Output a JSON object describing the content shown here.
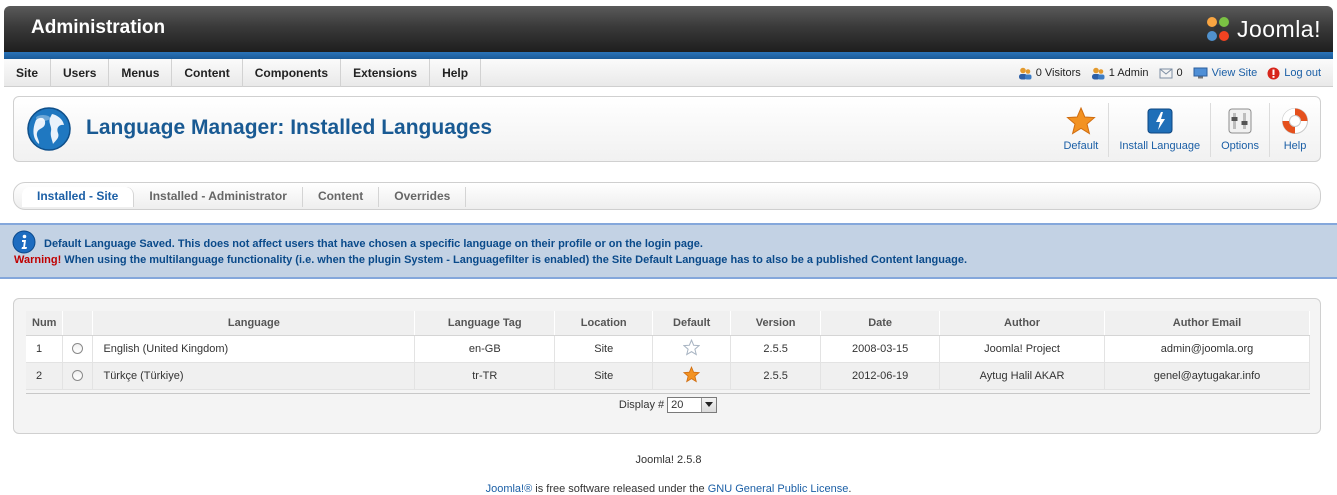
{
  "header": {
    "title": "Administration",
    "logo_text": "Joomla!"
  },
  "menu": {
    "items": [
      "Site",
      "Users",
      "Menus",
      "Content",
      "Components",
      "Extensions",
      "Help"
    ]
  },
  "status": {
    "visitors": "0 Visitors",
    "admins": "1 Admin",
    "messages": "0",
    "view_site": "View Site",
    "logout": "Log out"
  },
  "page": {
    "title": "Language Manager: Installed Languages"
  },
  "toolbar": {
    "default": "Default",
    "install": "Install Language",
    "options": "Options",
    "help": "Help"
  },
  "submenu": {
    "items": [
      "Installed - Site",
      "Installed - Administrator",
      "Content",
      "Overrides"
    ]
  },
  "message": {
    "info": "Default Language Saved. This does not affect users that have chosen a specific language on their profile or on the login page.",
    "warning_label": "Warning!",
    "warning_text": " When using the multilanguage functionality (i.e. when the plugin System - Languagefilter is enabled) the Site Default Language has to also be a published Content language."
  },
  "table": {
    "headers": [
      "Num",
      "",
      "Language",
      "Language Tag",
      "Location",
      "Default",
      "Version",
      "Date",
      "Author",
      "Author Email"
    ],
    "rows": [
      {
        "num": "1",
        "language": "English (United Kingdom)",
        "tag": "en-GB",
        "location": "Site",
        "is_default": false,
        "version": "2.5.5",
        "date": "2008-03-15",
        "author": "Joomla! Project",
        "email": "admin@joomla.org"
      },
      {
        "num": "2",
        "language": "Türkçe (Türkiye)",
        "tag": "tr-TR",
        "location": "Site",
        "is_default": true,
        "version": "2.5.5",
        "date": "2012-06-19",
        "author": "Aytug Halil AKAR",
        "email": "genel@aytugakar.info"
      }
    ],
    "display_label": "Display #",
    "display_value": "20"
  },
  "footer": {
    "version": "Joomla! 2.5.8",
    "license_prefix": "Joomla!®",
    "license_middle": " is free software released under the ",
    "license_link": "GNU General Public License",
    "license_suffix": "."
  },
  "colors": {
    "accent_blue": "#195a93",
    "link_blue": "#1b5fa6",
    "warning_red": "#c00000",
    "message_bg": "#c3d2e4",
    "star_orange": "#f39221"
  }
}
